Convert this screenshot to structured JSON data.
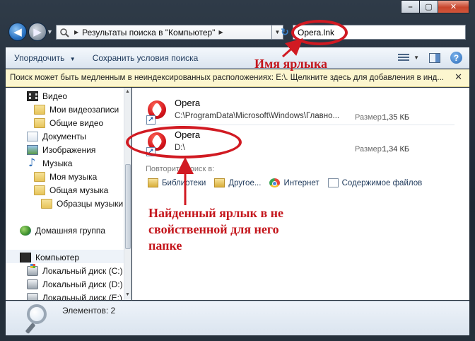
{
  "window": {
    "caption": {
      "minimize": "–",
      "maximize": "▢",
      "close": "✕"
    }
  },
  "addressbar": {
    "back_glyph": "◀",
    "forward_glyph": "▶",
    "crumb_arrow": "▶",
    "location": "Результаты поиска в \"Компьютер\"",
    "refresh_glyph": "↻",
    "search_value": "Opera.lnk"
  },
  "toolbar": {
    "organize": "Упорядочить",
    "save_search": "Сохранить условия поиска",
    "dropdown_glyph": "▼",
    "help_glyph": "?"
  },
  "infobar": {
    "text": "Поиск может быть медленным в неиндексированных расположениях: E:\\. Щелкните здесь для добавления в инд...",
    "close_glyph": "✕"
  },
  "navpane": {
    "items": [
      {
        "label": "Видео",
        "icon": "video-icon"
      },
      {
        "label": "Мои видеозаписи",
        "icon": "folder-icon"
      },
      {
        "label": "Общие видео",
        "icon": "folder-icon"
      },
      {
        "label": "Документы",
        "icon": "documents-icon"
      },
      {
        "label": "Изображения",
        "icon": "pictures-icon"
      },
      {
        "label": "Музыка",
        "icon": "music-icon"
      },
      {
        "label": "Моя музыка",
        "icon": "folder-icon"
      },
      {
        "label": "Общая музыка",
        "icon": "folder-icon"
      },
      {
        "label": "Образцы музыки",
        "icon": "folder-icon"
      },
      {
        "label": "Домашняя группа",
        "icon": "homegroup-icon"
      },
      {
        "label": "Компьютер",
        "icon": "computer-icon"
      },
      {
        "label": "Локальный диск (C:)",
        "icon": "drive-icon"
      },
      {
        "label": "Локальный диск (D:)",
        "icon": "drive-icon"
      },
      {
        "label": "Локальный диск (E:)",
        "icon": "drive-icon"
      }
    ]
  },
  "results": [
    {
      "name": "Opera",
      "path": "C:\\ProgramData\\Microsoft\\Windows\\Главно...",
      "size_label": "Размер:",
      "size": "1,35 КБ"
    },
    {
      "name": "Opera",
      "path": "D:\\",
      "size_label": "Размер:",
      "size": "1,34 КБ"
    }
  ],
  "repeat_search": {
    "label": "Повторить поиск в:",
    "options": [
      {
        "label": "Библиотеки",
        "icon": "libraries-icon"
      },
      {
        "label": "Другое...",
        "icon": "folder-icon"
      },
      {
        "label": "Интернет",
        "icon": "internet-icon"
      },
      {
        "label": "Содержимое файлов",
        "icon": "file-contents-icon"
      }
    ]
  },
  "statusbar": {
    "text": "Элементов: 2"
  },
  "annotations": {
    "shortcut_name": "Имя ярлыка",
    "found_line1": "Найденный ярлык в не",
    "found_line2": "свойственной для него",
    "found_line3": "папке",
    "color": "#c4161c"
  }
}
